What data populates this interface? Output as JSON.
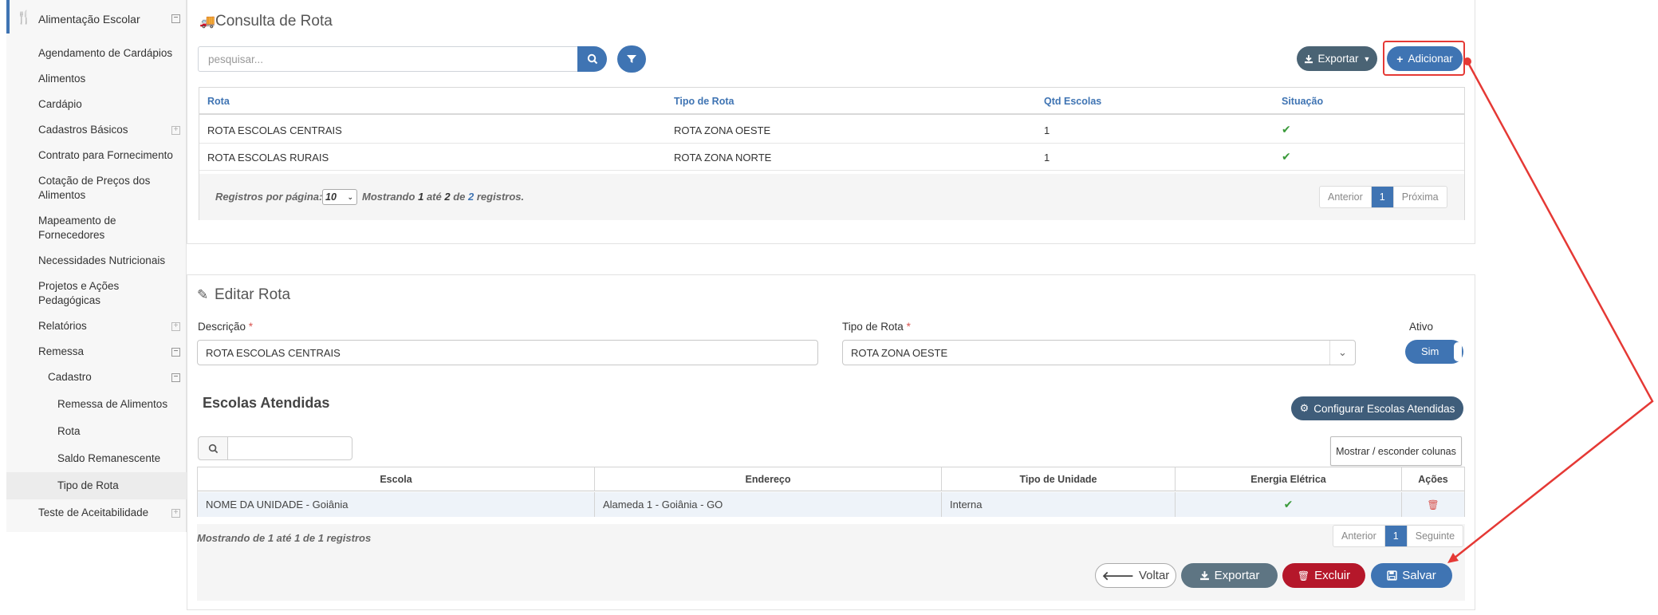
{
  "sidebar": {
    "header": "Alimentação Escolar",
    "items": [
      {
        "label": "Agendamento de Cardápios"
      },
      {
        "label": "Alimentos"
      },
      {
        "label": "Cardápio"
      },
      {
        "label": "Cadastros Básicos"
      },
      {
        "label": "Contrato para Fornecimento"
      },
      {
        "label": "Cotação de Preços dos",
        "label2": "Alimentos"
      },
      {
        "label": "Mapeamento de",
        "label2": "Fornecedores"
      },
      {
        "label": "Necessidades Nutricionais"
      },
      {
        "label": "Projetos e Ações",
        "label2": "Pedagógicas"
      },
      {
        "label": "Relatórios"
      },
      {
        "label": "Remessa"
      },
      {
        "label": "Cadastro"
      },
      {
        "label": "Remessa de Alimentos"
      },
      {
        "label": "Rota"
      },
      {
        "label": "Saldo Remanescente"
      },
      {
        "label": "Tipo de Rota"
      },
      {
        "label": "Teste de Aceitabilidade"
      }
    ]
  },
  "consulta": {
    "title": "Consulta de Rota",
    "search_placeholder": "pesquisar...",
    "export_label": "Exportar",
    "add_label": "Adicionar",
    "columns": [
      "Rota",
      "Tipo de Rota",
      "Qtd Escolas",
      "Situação"
    ],
    "rows": [
      {
        "rota": "ROTA ESCOLAS CENTRAIS",
        "tipo": "ROTA ZONA OESTE",
        "qtd": "1"
      },
      {
        "rota": "ROTA ESCOLAS RURAIS",
        "tipo": "ROTA ZONA NORTE",
        "qtd": "1"
      }
    ],
    "footer": {
      "per_page_label": "Registros por página:",
      "per_page_value": "10",
      "showing_1": "Mostrando",
      "from": "1",
      "to_word": "até",
      "to": "2",
      "of_word": "de",
      "total": "2",
      "records_word": "registros."
    },
    "pager": {
      "prev": "Anterior",
      "page": "1",
      "next": "Próxima"
    }
  },
  "editar": {
    "title": "Editar Rota",
    "descricao_label": "Descrição",
    "descricao_value": "ROTA ESCOLAS CENTRAIS",
    "tipo_label": "Tipo de Rota",
    "tipo_value": "ROTA ZONA OESTE",
    "ativo_label": "Ativo",
    "ativo_value": "Sim",
    "required_mark": "*",
    "section_title": "Escolas Atendidas",
    "config_label": "Configurar Escolas Atendidas",
    "cols_toggle_label": "Mostrar / esconder colunas",
    "columns": [
      "Escola",
      "Endereço",
      "Tipo de Unidade",
      "Energia Elétrica",
      "Ações"
    ],
    "rows": [
      {
        "escola": "NOME DA UNIDADE - Goiânia",
        "endereco": "Alameda 1 - Goiânia - GO",
        "tipo": "Interna"
      }
    ],
    "footer_text": "Mostrando de 1 até 1 de 1 registros",
    "pager": {
      "prev": "Anterior",
      "page": "1",
      "next": "Seguinte"
    },
    "buttons": {
      "voltar": "Voltar",
      "exportar": "Exportar",
      "excluir": "Excluir",
      "salvar": "Salvar"
    }
  },
  "colors": {
    "primary": "#3f74b3",
    "danger": "#b5172a",
    "annotation": "#e53935",
    "success": "#3a9a3a"
  }
}
